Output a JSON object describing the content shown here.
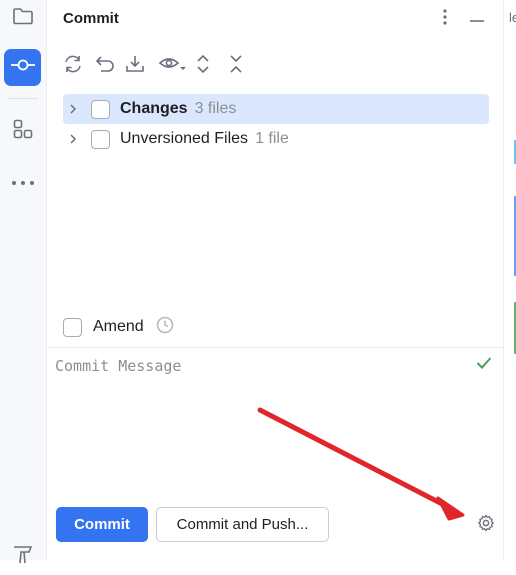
{
  "stripe": {
    "items": [
      {
        "name": "project",
        "icon": "folder-icon"
      },
      {
        "name": "commit",
        "icon": "commit-icon",
        "active": true
      },
      {
        "name": "structure",
        "icon": "structure-icon"
      },
      {
        "name": "more",
        "icon": "more-horizontal-icon"
      },
      {
        "name": "build",
        "icon": "hammer-icon"
      }
    ]
  },
  "header": {
    "title": "Commit",
    "options_icon": "more-vertical-icon",
    "hide_icon": "minimize-icon"
  },
  "toolbar": {
    "icons": [
      "refresh-icon",
      "rollback-icon",
      "shelve-icon",
      "show-diff-icon",
      "expand-all-icon",
      "collapse-all-icon"
    ]
  },
  "tree": {
    "changes_label": "Changes",
    "changes_count": "3 files",
    "unversioned_label": "Unversioned Files",
    "unversioned_count": "1 file"
  },
  "amend": {
    "label": "Amend"
  },
  "message": {
    "placeholder": "Commit Message",
    "value": ""
  },
  "actions": {
    "commit_label": "Commit",
    "commit_push_label": "Commit and Push..."
  },
  "editor": {
    "tab_fragment": "le"
  },
  "colors": {
    "accent": "#3574f0",
    "selection": "#dbe7fd",
    "ok_check": "#4a9d5b",
    "annotation_arrow": "#e0262b"
  }
}
